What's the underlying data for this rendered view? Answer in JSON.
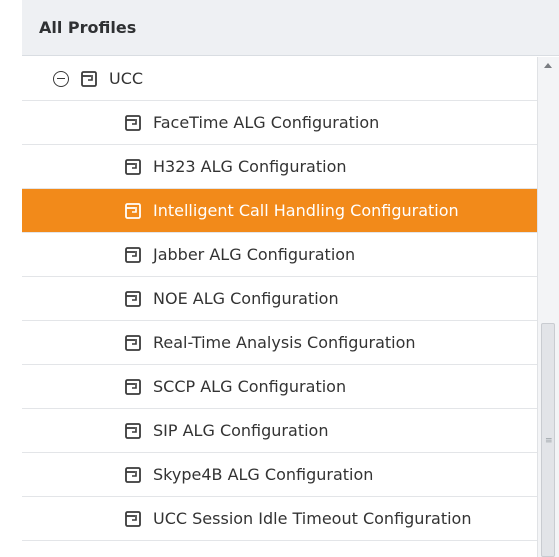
{
  "panel": {
    "title": "All Profiles"
  },
  "tree": {
    "group": {
      "label": "UCC",
      "expanded": true
    },
    "items": [
      {
        "label": "FaceTime ALG Configuration",
        "selected": false
      },
      {
        "label": "H323 ALG Configuration",
        "selected": false
      },
      {
        "label": "Intelligent Call Handling Configuration",
        "selected": true
      },
      {
        "label": "Jabber ALG Configuration",
        "selected": false
      },
      {
        "label": "NOE ALG Configuration",
        "selected": false
      },
      {
        "label": "Real-Time Analysis Configuration",
        "selected": false
      },
      {
        "label": "SCCP ALG Configuration",
        "selected": false
      },
      {
        "label": "SIP ALG Configuration",
        "selected": false
      },
      {
        "label": "Skype4B ALG Configuration",
        "selected": false
      },
      {
        "label": "UCC Session Idle Timeout Configuration",
        "selected": false
      }
    ]
  },
  "colors": {
    "selected_bg": "#f28a1a",
    "header_bg": "#eef0f3"
  },
  "icons": {
    "collapse": "collapse-circle-minus-icon",
    "page": "page-icon"
  }
}
